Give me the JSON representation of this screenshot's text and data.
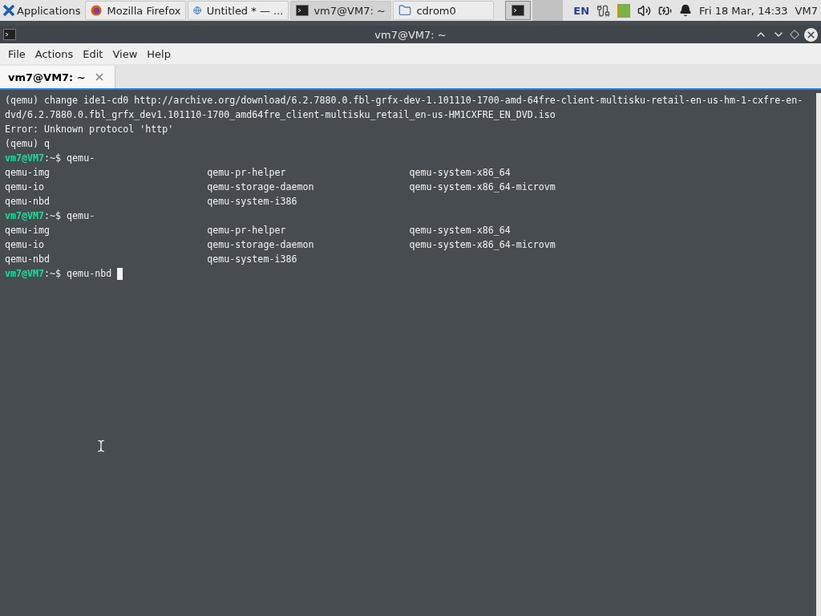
{
  "taskbar": {
    "apps_label": "Applications",
    "tasks": [
      {
        "label": "Mozilla Firefox",
        "kind": "browser",
        "selected": false
      },
      {
        "label": "Untitled * — ...",
        "kind": "editor",
        "selected": false
      },
      {
        "label": "vm7@VM7: ~",
        "kind": "terminal",
        "selected": true
      },
      {
        "label": "cdrom0",
        "kind": "folder",
        "selected": false
      }
    ],
    "language": "EN",
    "clock": "Fri 18 Mar, 14:33",
    "user": "VM7"
  },
  "window": {
    "title": "vm7@VM7: ~"
  },
  "menu": [
    "File",
    "Actions",
    "Edit",
    "View",
    "Help"
  ],
  "tabs": [
    {
      "label": "vm7@VM7: ~",
      "selected": true
    }
  ],
  "terminal": {
    "lines": [
      {
        "kind": "output",
        "text": "(qemu) change ide1-cd0 http://archive.org/download/6.2.7880.0.fbl-grfx-dev-1.101110-1700-amd-64fre-client-multisku-retail-en-us-hm-1-cxfre-en-dvd/6.2.7880.0.fbl_grfx_dev1.101110-1700_amd64fre_client-multisku_retail_en-us-HM1CXFRE_EN_DVD.iso"
      },
      {
        "kind": "output",
        "text": "Error: Unknown protocol 'http'"
      },
      {
        "kind": "output",
        "text": "(qemu) q"
      },
      {
        "kind": "prompt",
        "user": "vm7@VM7",
        "path": ":~$",
        "command": "qemu-",
        "cursor": false
      },
      {
        "kind": "columns",
        "cells": [
          "qemu-img",
          "qemu-pr-helper",
          "qemu-system-x86_64"
        ]
      },
      {
        "kind": "columns",
        "cells": [
          "qemu-io",
          "qemu-storage-daemon",
          "qemu-system-x86_64-microvm"
        ]
      },
      {
        "kind": "columns",
        "cells": [
          "qemu-nbd",
          "qemu-system-i386"
        ]
      },
      {
        "kind": "prompt",
        "user": "vm7@VM7",
        "path": ":~$",
        "command": "qemu-",
        "cursor": false
      },
      {
        "kind": "columns",
        "cells": [
          "qemu-img",
          "qemu-pr-helper",
          "qemu-system-x86_64"
        ]
      },
      {
        "kind": "columns",
        "cells": [
          "qemu-io",
          "qemu-storage-daemon",
          "qemu-system-x86_64-microvm"
        ]
      },
      {
        "kind": "columns",
        "cells": [
          "qemu-nbd",
          "qemu-system-i386"
        ]
      },
      {
        "kind": "prompt",
        "user": "vm7@VM7",
        "path": ":~$",
        "command": "qemu-nbd",
        "cursor": true
      }
    ]
  }
}
